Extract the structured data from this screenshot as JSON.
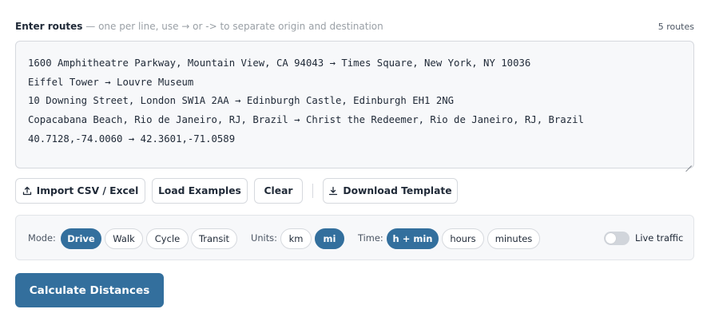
{
  "routes_label": {
    "title": "Enter routes",
    "hint": " — one per line, use → or -> to separate origin and destination",
    "count": "5 routes"
  },
  "routes": [
    "1600 Amphitheatre Parkway, Mountain View, CA 94043 → Times Square, New York, NY 10036",
    "Eiffel Tower → Louvre Museum",
    "10 Downing Street, London SW1A 2AA → Edinburgh Castle, Edinburgh EH1 2NG",
    "Copacabana Beach, Rio de Janeiro, RJ, Brazil → Christ the Redeemer, Rio de Janeiro, RJ, Brazil",
    "40.7128,-74.0060 → 42.3601,-71.0589"
  ],
  "actions": {
    "import": {
      "label": "Import CSV / Excel",
      "icon": "upload-icon"
    },
    "examples": {
      "label": "Load Examples"
    },
    "clear": {
      "label": "Clear"
    },
    "template": {
      "label": "Download Template",
      "icon": "download-icon"
    }
  },
  "options": {
    "mode": {
      "label": "Mode:",
      "items": [
        "Drive",
        "Walk",
        "Cycle",
        "Transit"
      ],
      "selected": "Drive"
    },
    "units": {
      "label": "Units:",
      "items": [
        "km",
        "mi"
      ],
      "selected": "mi"
    },
    "time": {
      "label": "Time:",
      "items": [
        "h + min",
        "hours",
        "minutes"
      ],
      "selected": "h + min"
    },
    "live_traffic": {
      "label": "Live traffic",
      "enabled": false
    }
  },
  "calculate": {
    "label": "Calculate Distances"
  },
  "colors": {
    "accent": "#336f9d",
    "panel": "#f7f8fa",
    "border": "#d6d9de"
  }
}
